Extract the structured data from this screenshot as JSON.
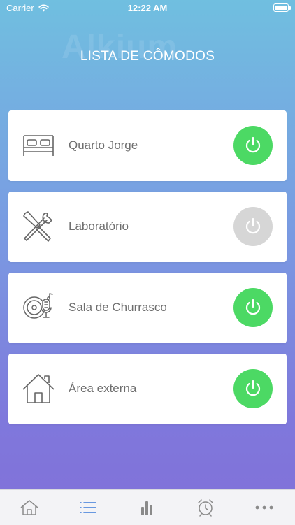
{
  "status_bar": {
    "carrier": "Carrier",
    "time": "12:22 AM"
  },
  "watermark": "Alkium",
  "title": "LISTA DE CÔMODOS",
  "colors": {
    "power_on": "#4cd964",
    "power_off": "#d6d6d6",
    "tab_active": "#3b7ad9",
    "tab_inactive": "#8a8a8a"
  },
  "rooms": [
    {
      "label": "Quarto Jorge",
      "icon": "bed-icon",
      "power": "on"
    },
    {
      "label": "Laboratório",
      "icon": "tools-icon",
      "power": "off"
    },
    {
      "label": "Sala de Churrasco",
      "icon": "vinyl-microphone-icon",
      "power": "on"
    },
    {
      "label": "Área externa",
      "icon": "house-icon",
      "power": "on"
    }
  ],
  "tabs": [
    {
      "name": "home",
      "icon": "house-icon",
      "active": false
    },
    {
      "name": "list",
      "icon": "list-icon",
      "active": true
    },
    {
      "name": "stats",
      "icon": "bar-chart-icon",
      "active": false
    },
    {
      "name": "alarm",
      "icon": "alarm-clock-icon",
      "active": false
    },
    {
      "name": "more",
      "icon": "more-dots-icon",
      "active": false
    }
  ]
}
